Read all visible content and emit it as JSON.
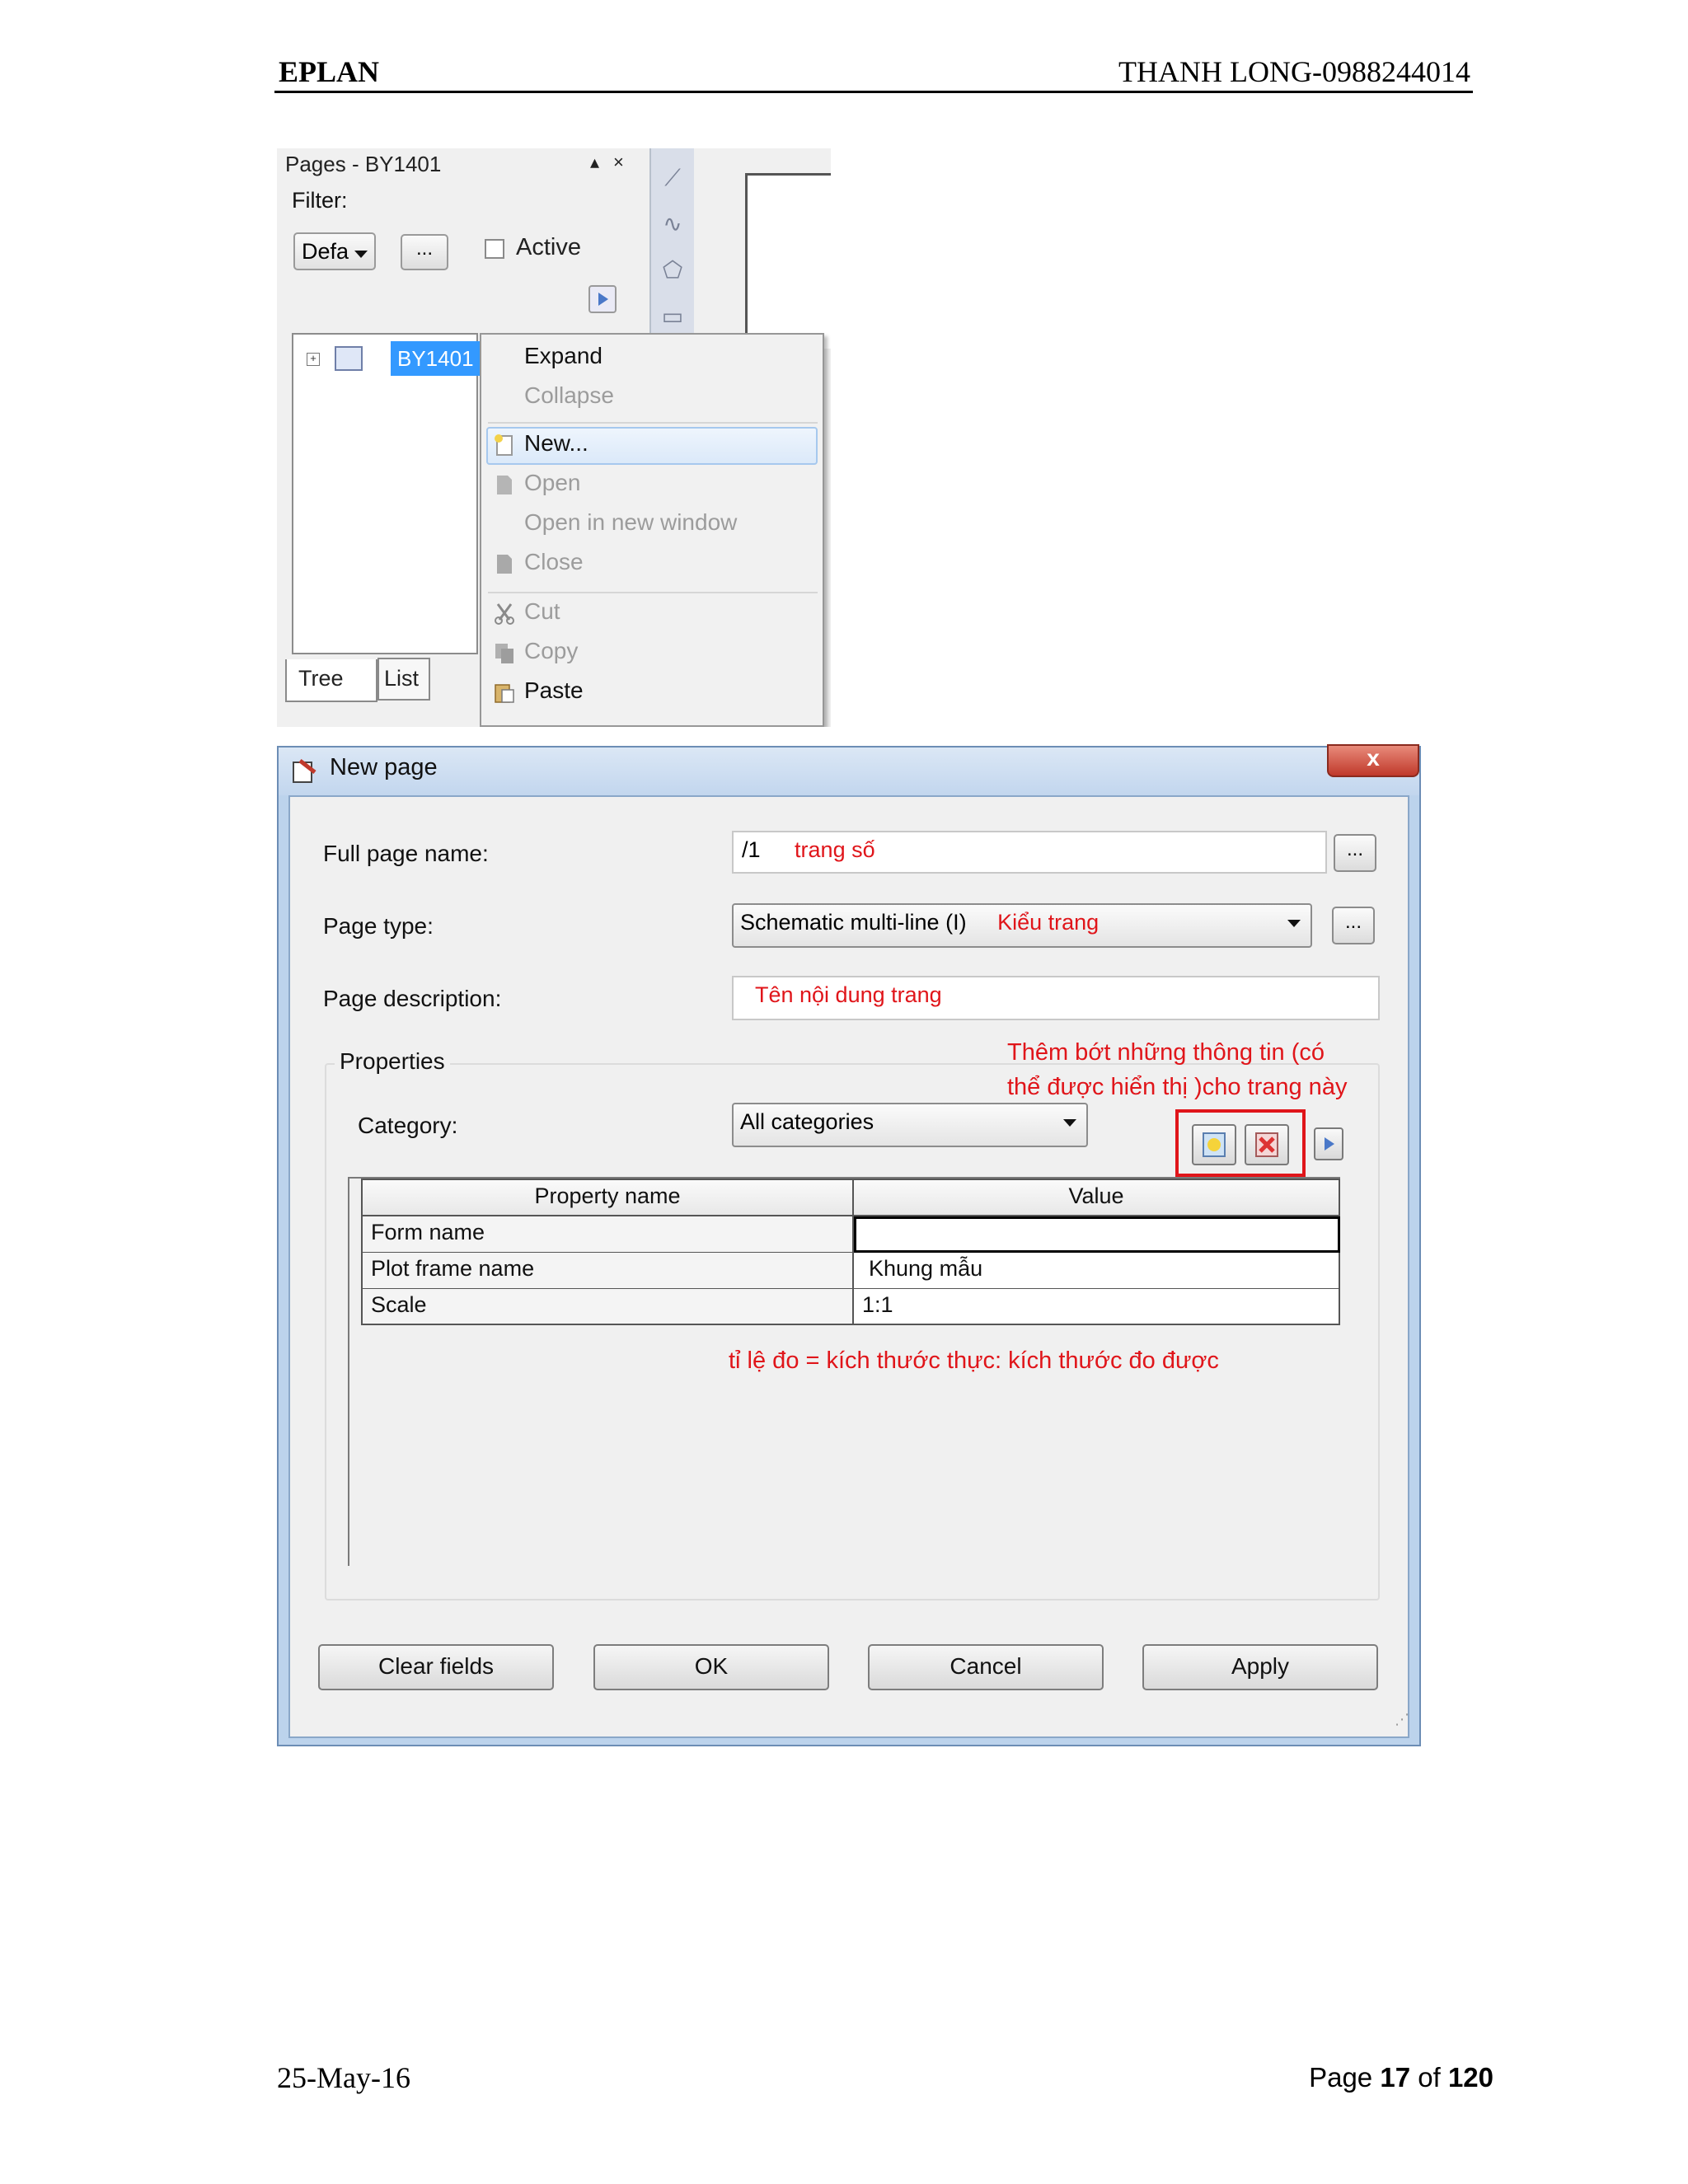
{
  "header": {
    "left": "EPLAN",
    "right": "THANH LONG-0988244014"
  },
  "footer": {
    "date": "25-May-16",
    "page_prefix": "Page",
    "page_num": "17",
    "page_of": "of",
    "page_total": "120"
  },
  "pages_panel": {
    "title": "Pages - BY1401",
    "filter_label": "Filter:",
    "filter_value": "Defa",
    "more_button": "...",
    "active_label": "Active",
    "tree_node": "BY1401",
    "tabs": [
      "Tree",
      "List"
    ],
    "context_menu": {
      "expand": "Expand",
      "collapse": "Collapse",
      "new": "New...",
      "open": "Open",
      "open_new_window": "Open in new window",
      "close": "Close",
      "cut": "Cut",
      "copy": "Copy",
      "paste": "Paste"
    }
  },
  "dialog": {
    "title": "New page",
    "close_glyph": "x",
    "full_page_name_label": "Full page name:",
    "full_page_name_value": "/1",
    "full_page_name_note": "trang số",
    "page_type_label": "Page type:",
    "page_type_value": "Schematic multi-line (I)",
    "page_type_note": "Kiểu trang",
    "page_description_label": "Page description:",
    "page_description_note": "Tên nội dung trang",
    "ellipsis": "...",
    "properties_label": "Properties",
    "annotation_properties_line1": "Thêm bớt những thông tin (có",
    "annotation_properties_line2": "thể được hiển thị )cho trang này",
    "category_label": "Category:",
    "category_value": "All categories",
    "table_headers": {
      "name": "Property name",
      "value": "Value"
    },
    "rows": [
      {
        "name": "Form name",
        "value": ""
      },
      {
        "name": "Plot frame name",
        "value": "Khung mẫu"
      },
      {
        "name": "Scale",
        "value": "1:1"
      }
    ],
    "scale_annotation": "tỉ lệ đo = kích thước thực: kích thước đo được",
    "buttons": {
      "clear": "Clear fields",
      "ok": "OK",
      "cancel": "Cancel",
      "apply": "Apply"
    }
  },
  "colors": {
    "annotation_red": "#e0151a",
    "selection_blue": "#3399ff",
    "dialog_frame": "#bcd3ec"
  }
}
